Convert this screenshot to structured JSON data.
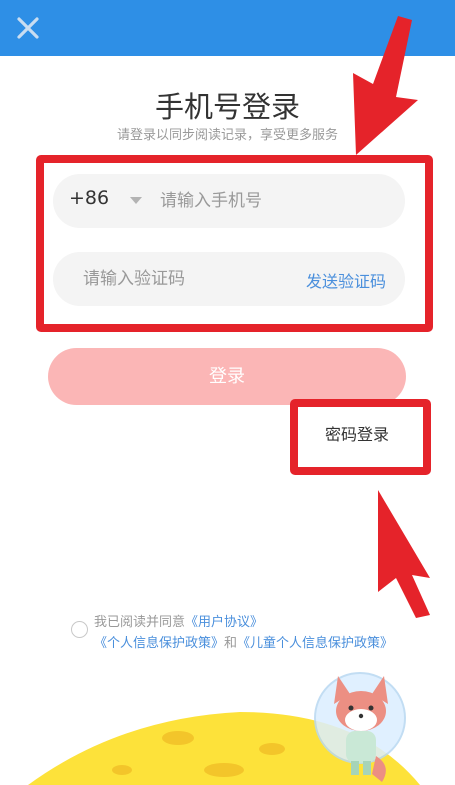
{
  "header": {
    "background_color": "#2e8fe6",
    "close_icon": "close-icon"
  },
  "login": {
    "title": "手机号登录",
    "subtitle": "请登录以同步阅读记录，享受更多服务",
    "country_code": "+86",
    "country_code_dropdown_icon": "chevron-down-icon",
    "phone_placeholder": "请输入手机号",
    "code_placeholder": "请输入验证码",
    "send_code_label": "发送验证码",
    "login_button_label": "登录",
    "password_login_label": "密码登录"
  },
  "agreement": {
    "prefix": "我已阅读并同意",
    "user_agreement": "《用户协议》",
    "privacy_policy": "《个人信息保护政策》",
    "and": "和",
    "child_privacy_policy": "《儿童个人信息保护政策》"
  },
  "colors": {
    "accent_blue": "#2e8fe6",
    "link_blue": "#4a8fdc",
    "login_button_pink": "#fbb6b6",
    "annotation_red": "#e5232a",
    "moon_yellow": "#fde23a"
  }
}
